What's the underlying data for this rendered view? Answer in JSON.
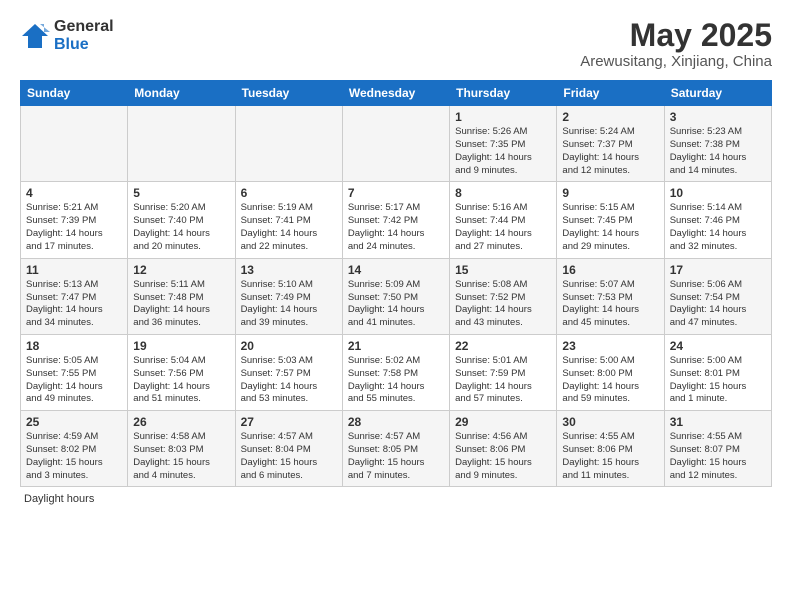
{
  "logo": {
    "general": "General",
    "blue": "Blue"
  },
  "title": "May 2025",
  "subtitle": "Arewusitang, Xinjiang, China",
  "days_header": [
    "Sunday",
    "Monday",
    "Tuesday",
    "Wednesday",
    "Thursday",
    "Friday",
    "Saturday"
  ],
  "weeks": [
    [
      {
        "num": "",
        "info": ""
      },
      {
        "num": "",
        "info": ""
      },
      {
        "num": "",
        "info": ""
      },
      {
        "num": "",
        "info": ""
      },
      {
        "num": "1",
        "info": "Sunrise: 5:26 AM\nSunset: 7:35 PM\nDaylight: 14 hours\nand 9 minutes."
      },
      {
        "num": "2",
        "info": "Sunrise: 5:24 AM\nSunset: 7:37 PM\nDaylight: 14 hours\nand 12 minutes."
      },
      {
        "num": "3",
        "info": "Sunrise: 5:23 AM\nSunset: 7:38 PM\nDaylight: 14 hours\nand 14 minutes."
      }
    ],
    [
      {
        "num": "4",
        "info": "Sunrise: 5:21 AM\nSunset: 7:39 PM\nDaylight: 14 hours\nand 17 minutes."
      },
      {
        "num": "5",
        "info": "Sunrise: 5:20 AM\nSunset: 7:40 PM\nDaylight: 14 hours\nand 20 minutes."
      },
      {
        "num": "6",
        "info": "Sunrise: 5:19 AM\nSunset: 7:41 PM\nDaylight: 14 hours\nand 22 minutes."
      },
      {
        "num": "7",
        "info": "Sunrise: 5:17 AM\nSunset: 7:42 PM\nDaylight: 14 hours\nand 24 minutes."
      },
      {
        "num": "8",
        "info": "Sunrise: 5:16 AM\nSunset: 7:44 PM\nDaylight: 14 hours\nand 27 minutes."
      },
      {
        "num": "9",
        "info": "Sunrise: 5:15 AM\nSunset: 7:45 PM\nDaylight: 14 hours\nand 29 minutes."
      },
      {
        "num": "10",
        "info": "Sunrise: 5:14 AM\nSunset: 7:46 PM\nDaylight: 14 hours\nand 32 minutes."
      }
    ],
    [
      {
        "num": "11",
        "info": "Sunrise: 5:13 AM\nSunset: 7:47 PM\nDaylight: 14 hours\nand 34 minutes."
      },
      {
        "num": "12",
        "info": "Sunrise: 5:11 AM\nSunset: 7:48 PM\nDaylight: 14 hours\nand 36 minutes."
      },
      {
        "num": "13",
        "info": "Sunrise: 5:10 AM\nSunset: 7:49 PM\nDaylight: 14 hours\nand 39 minutes."
      },
      {
        "num": "14",
        "info": "Sunrise: 5:09 AM\nSunset: 7:50 PM\nDaylight: 14 hours\nand 41 minutes."
      },
      {
        "num": "15",
        "info": "Sunrise: 5:08 AM\nSunset: 7:52 PM\nDaylight: 14 hours\nand 43 minutes."
      },
      {
        "num": "16",
        "info": "Sunrise: 5:07 AM\nSunset: 7:53 PM\nDaylight: 14 hours\nand 45 minutes."
      },
      {
        "num": "17",
        "info": "Sunrise: 5:06 AM\nSunset: 7:54 PM\nDaylight: 14 hours\nand 47 minutes."
      }
    ],
    [
      {
        "num": "18",
        "info": "Sunrise: 5:05 AM\nSunset: 7:55 PM\nDaylight: 14 hours\nand 49 minutes."
      },
      {
        "num": "19",
        "info": "Sunrise: 5:04 AM\nSunset: 7:56 PM\nDaylight: 14 hours\nand 51 minutes."
      },
      {
        "num": "20",
        "info": "Sunrise: 5:03 AM\nSunset: 7:57 PM\nDaylight: 14 hours\nand 53 minutes."
      },
      {
        "num": "21",
        "info": "Sunrise: 5:02 AM\nSunset: 7:58 PM\nDaylight: 14 hours\nand 55 minutes."
      },
      {
        "num": "22",
        "info": "Sunrise: 5:01 AM\nSunset: 7:59 PM\nDaylight: 14 hours\nand 57 minutes."
      },
      {
        "num": "23",
        "info": "Sunrise: 5:00 AM\nSunset: 8:00 PM\nDaylight: 14 hours\nand 59 minutes."
      },
      {
        "num": "24",
        "info": "Sunrise: 5:00 AM\nSunset: 8:01 PM\nDaylight: 15 hours\nand 1 minute."
      }
    ],
    [
      {
        "num": "25",
        "info": "Sunrise: 4:59 AM\nSunset: 8:02 PM\nDaylight: 15 hours\nand 3 minutes."
      },
      {
        "num": "26",
        "info": "Sunrise: 4:58 AM\nSunset: 8:03 PM\nDaylight: 15 hours\nand 4 minutes."
      },
      {
        "num": "27",
        "info": "Sunrise: 4:57 AM\nSunset: 8:04 PM\nDaylight: 15 hours\nand 6 minutes."
      },
      {
        "num": "28",
        "info": "Sunrise: 4:57 AM\nSunset: 8:05 PM\nDaylight: 15 hours\nand 7 minutes."
      },
      {
        "num": "29",
        "info": "Sunrise: 4:56 AM\nSunset: 8:06 PM\nDaylight: 15 hours\nand 9 minutes."
      },
      {
        "num": "30",
        "info": "Sunrise: 4:55 AM\nSunset: 8:06 PM\nDaylight: 15 hours\nand 11 minutes."
      },
      {
        "num": "31",
        "info": "Sunrise: 4:55 AM\nSunset: 8:07 PM\nDaylight: 15 hours\nand 12 minutes."
      }
    ]
  ],
  "footer": "Daylight hours"
}
